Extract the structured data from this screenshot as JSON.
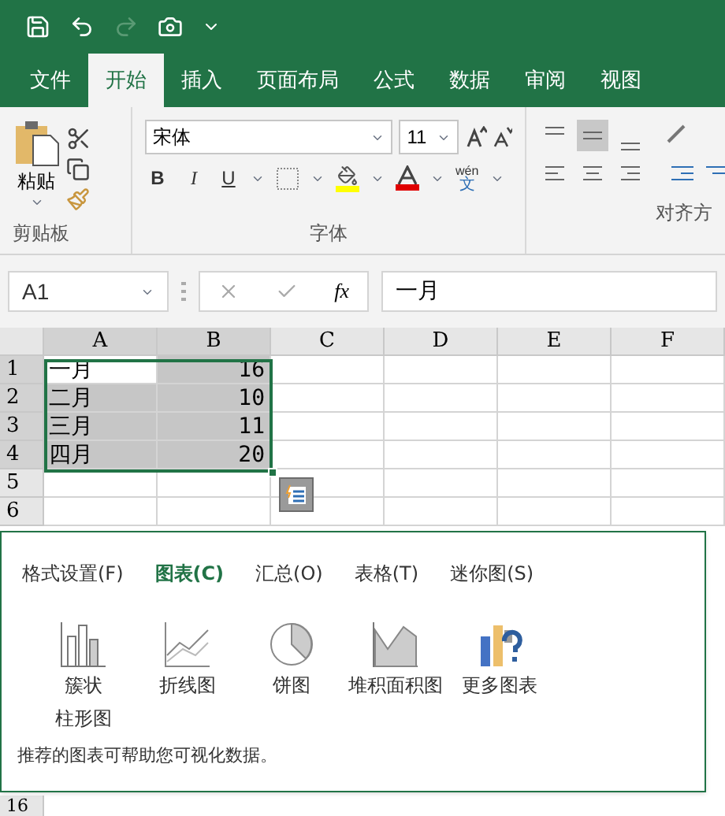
{
  "ribbon_tabs": [
    {
      "label": "文件",
      "selected": false
    },
    {
      "label": "开始",
      "selected": true
    },
    {
      "label": "插入",
      "selected": false
    },
    {
      "label": "页面布局",
      "selected": false
    },
    {
      "label": "公式",
      "selected": false
    },
    {
      "label": "数据",
      "selected": false
    },
    {
      "label": "审阅",
      "selected": false
    },
    {
      "label": "视图",
      "selected": false
    }
  ],
  "clipboard": {
    "paste_label": "粘贴",
    "group_label": "剪贴板"
  },
  "font": {
    "name": "宋体",
    "size": "11",
    "bold": "B",
    "italic": "I",
    "underline": "U",
    "phonetic_top": "wén",
    "phonetic_bottom": "文",
    "group_label": "字体"
  },
  "alignment": {
    "group_label": "对齐方"
  },
  "formula_bar": {
    "name_box": "A1",
    "fx": "fx",
    "value": "一月"
  },
  "sheet": {
    "columns": [
      "A",
      "B",
      "C",
      "D",
      "E",
      "F"
    ],
    "rows": [
      {
        "header": "1",
        "cells": [
          "一月",
          "16"
        ],
        "selected": true
      },
      {
        "header": "2",
        "cells": [
          "二月",
          "10"
        ],
        "selected": true
      },
      {
        "header": "3",
        "cells": [
          "三月",
          "11"
        ],
        "selected": true
      },
      {
        "header": "4",
        "cells": [
          "四月",
          "20"
        ],
        "selected": true
      },
      {
        "header": "5",
        "cells": [],
        "selected": false
      },
      {
        "header": "6",
        "cells": [],
        "selected": false
      }
    ],
    "bottom_row": "16"
  },
  "quick_analysis": {
    "tabs": [
      {
        "label": "格式设置(F)",
        "selected": false
      },
      {
        "label": "图表(C)",
        "selected": true
      },
      {
        "label": "汇总(O)",
        "selected": false
      },
      {
        "label": "表格(T)",
        "selected": false
      },
      {
        "label": "迷你图(S)",
        "selected": false
      }
    ],
    "options": [
      {
        "kind": "column",
        "label_lines": [
          "簇状",
          "柱形图"
        ]
      },
      {
        "kind": "line",
        "label_lines": [
          "折线图"
        ]
      },
      {
        "kind": "pie",
        "label_lines": [
          "饼图"
        ]
      },
      {
        "kind": "area",
        "label_lines": [
          "堆积面积图"
        ]
      },
      {
        "kind": "more",
        "label_lines": [
          "更多图表"
        ]
      }
    ],
    "hint": "推荐的图表可帮助您可视化数据。"
  }
}
